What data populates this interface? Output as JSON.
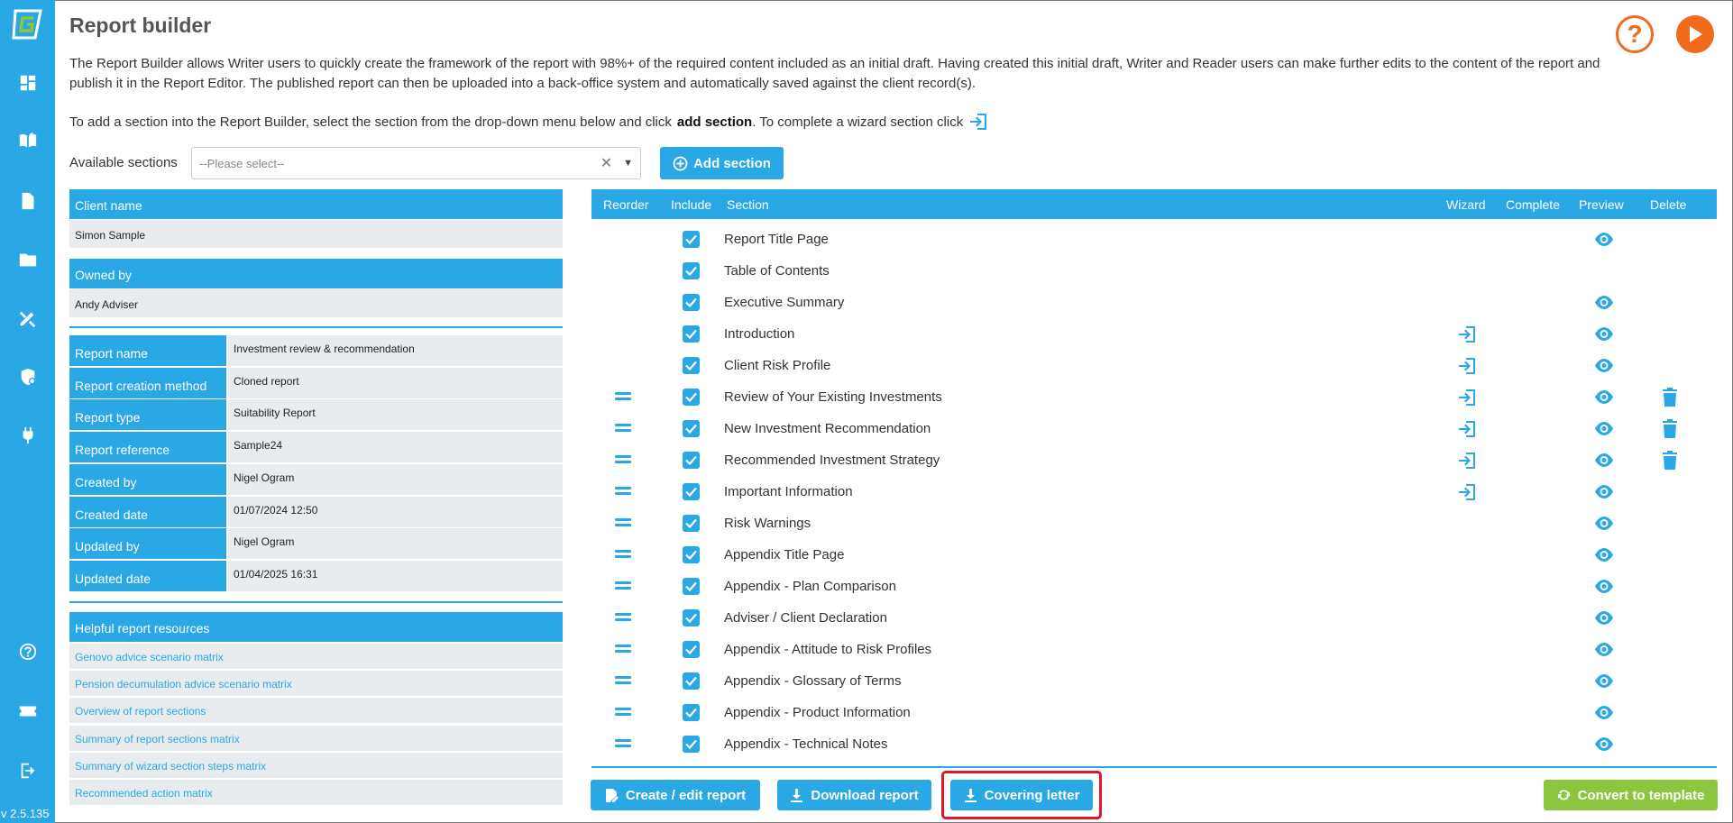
{
  "app": {
    "title": "Report builder",
    "version": "v 2.5.135",
    "intro_text": "The Report Builder allows Writer users to quickly create the framework of the report with 98%+ of the required content included as an initial draft. Having created this initial draft, Writer and Reader users can make further edits to the content of the report and publish it in the Report Editor. The published report can then be uploaded into a back-office system and automatically saved against the client record(s).",
    "instruction_pre": "To add a section into the Report Builder, select the section from the drop-down menu below and click",
    "instruction_bold": "add section",
    "instruction_post": ". To complete a wizard section click",
    "help_symbol": "?"
  },
  "sidebar": {
    "icons": [
      "dashboard-icon",
      "library-icon",
      "document-icon",
      "folder-icon",
      "tools-icon",
      "shield-settings-icon",
      "plug-icon",
      "help-circle-icon",
      "ticket-icon",
      "logout-icon"
    ]
  },
  "sections_select": {
    "label": "Available sections",
    "placeholder": "--Please select--",
    "add_label": "Add section"
  },
  "client": {
    "client_name_label": "Client name",
    "client_name": "Simon Sample",
    "owned_by_label": "Owned by",
    "owned_by": "Andy Adviser"
  },
  "report_details": [
    {
      "label": "Report name",
      "value": "Investment review & recommendation"
    },
    {
      "label": "Report creation method",
      "value": "Cloned report"
    },
    {
      "label": "Report type",
      "value": "Suitability Report"
    },
    {
      "label": "Report reference",
      "value": "Sample24"
    },
    {
      "label": "Created by",
      "value": "Nigel Ogram"
    },
    {
      "label": "Created date",
      "value": "01/07/2024 12:50"
    },
    {
      "label": "Updated by",
      "value": "Nigel Ogram"
    },
    {
      "label": "Updated date",
      "value": "01/04/2025 16:31"
    }
  ],
  "resources": {
    "title": "Helpful report resources",
    "links": [
      "Genovo advice scenario matrix",
      "Pension decumulation advice scenario matrix",
      "Overview of report sections",
      "Summary of report sections matrix",
      "Summary of wizard section steps matrix",
      "Recommended action matrix"
    ]
  },
  "table": {
    "headers": {
      "reorder": "Reorder",
      "include": "Include",
      "section": "Section",
      "wizard": "Wizard",
      "complete": "Complete",
      "preview": "Preview",
      "delete": "Delete"
    },
    "rows": [
      {
        "name": "Report Title Page",
        "reorder": false,
        "included": true,
        "wizard": false,
        "preview": true,
        "delete": false
      },
      {
        "name": "Table of Contents",
        "reorder": false,
        "included": true,
        "wizard": false,
        "preview": false,
        "delete": false
      },
      {
        "name": "Executive Summary",
        "reorder": false,
        "included": true,
        "wizard": false,
        "preview": true,
        "delete": false
      },
      {
        "name": "Introduction",
        "reorder": false,
        "included": true,
        "wizard": true,
        "preview": true,
        "delete": false
      },
      {
        "name": "Client Risk Profile",
        "reorder": false,
        "included": true,
        "wizard": true,
        "preview": true,
        "delete": false
      },
      {
        "name": "Review of Your Existing Investments",
        "reorder": true,
        "included": true,
        "wizard": true,
        "preview": true,
        "delete": true
      },
      {
        "name": "New Investment Recommendation",
        "reorder": true,
        "included": true,
        "wizard": true,
        "preview": true,
        "delete": true
      },
      {
        "name": "Recommended Investment Strategy",
        "reorder": true,
        "included": true,
        "wizard": true,
        "preview": true,
        "delete": true
      },
      {
        "name": "Important Information",
        "reorder": true,
        "included": true,
        "wizard": true,
        "preview": true,
        "delete": false
      },
      {
        "name": "Risk Warnings",
        "reorder": true,
        "included": true,
        "wizard": false,
        "preview": true,
        "delete": false
      },
      {
        "name": "Appendix Title Page",
        "reorder": true,
        "included": true,
        "wizard": false,
        "preview": true,
        "delete": false
      },
      {
        "name": "Appendix - Plan Comparison",
        "reorder": true,
        "included": true,
        "wizard": false,
        "preview": true,
        "delete": false
      },
      {
        "name": "Adviser / Client Declaration",
        "reorder": true,
        "included": true,
        "wizard": false,
        "preview": true,
        "delete": false
      },
      {
        "name": "Appendix - Attitude to Risk Profiles",
        "reorder": true,
        "included": true,
        "wizard": false,
        "preview": true,
        "delete": false
      },
      {
        "name": "Appendix - Glossary of Terms",
        "reorder": true,
        "included": true,
        "wizard": false,
        "preview": true,
        "delete": false
      },
      {
        "name": "Appendix - Product Information",
        "reorder": true,
        "included": true,
        "wizard": false,
        "preview": true,
        "delete": false
      },
      {
        "name": "Appendix - Technical Notes",
        "reorder": true,
        "included": true,
        "wizard": false,
        "preview": true,
        "delete": false
      }
    ]
  },
  "actions": {
    "create_edit": "Create / edit report",
    "download": "Download report",
    "covering_letter": "Covering letter",
    "convert": "Convert to template"
  },
  "colors": {
    "accent": "#29a8e5",
    "orange": "#f26b1d",
    "green": "#8cc63f",
    "highlight": "#e4142a"
  }
}
